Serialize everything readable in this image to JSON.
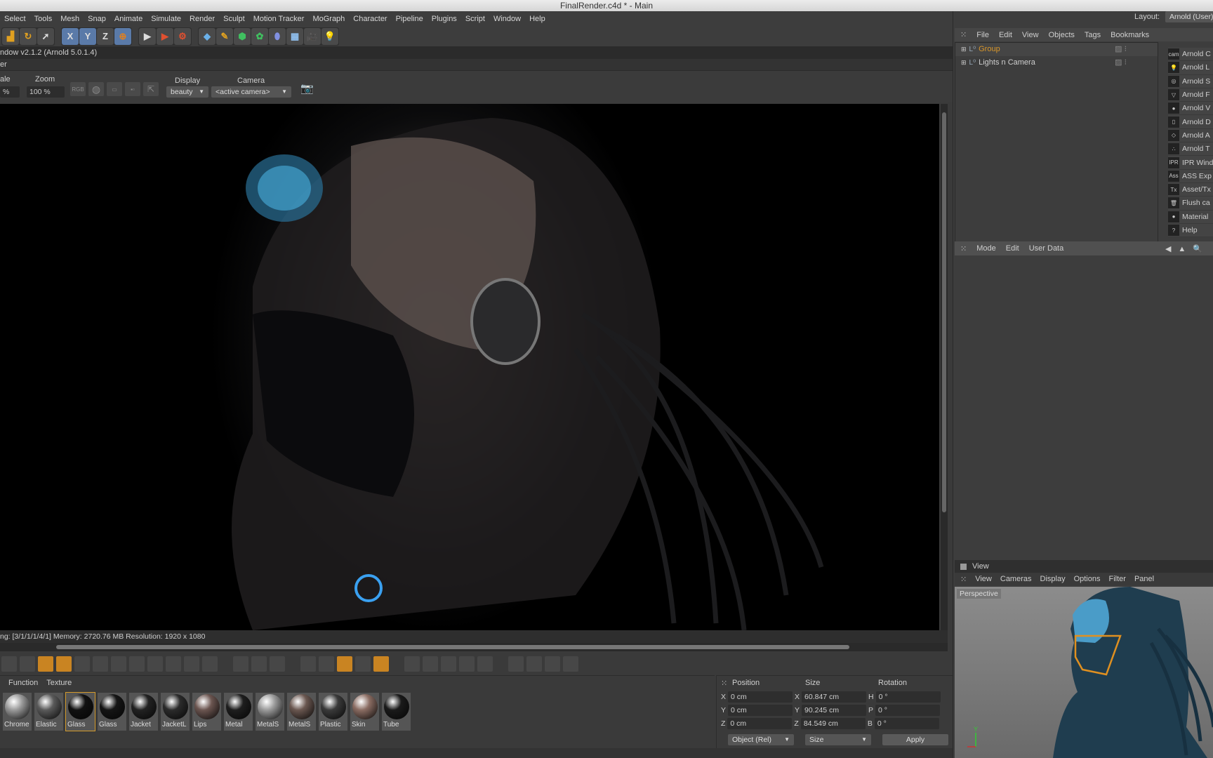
{
  "title": "FinalRender.c4d * - Main",
  "menu": [
    "Select",
    "Tools",
    "Mesh",
    "Snap",
    "Animate",
    "Simulate",
    "Render",
    "Sculpt",
    "Motion Tracker",
    "MoGraph",
    "Character",
    "Pipeline",
    "Plugins",
    "Script",
    "Window",
    "Help"
  ],
  "toolbar": {
    "axis": [
      "X",
      "Y",
      "Z"
    ]
  },
  "render_window": {
    "header": "ndow v2.1.2 (Arnold 5.0.1.4)",
    "sub": "er",
    "scale_label": "ale",
    "scale_value": "%",
    "zoom_label": "Zoom",
    "zoom_value": "100 %",
    "rgb": "RGB",
    "display_label": "Display",
    "display_value": "beauty",
    "camera_label": "Camera",
    "camera_value": "<active camera>",
    "status": "ng: [3/1/1/1/4/1]  Memory: 2720.76 MB  Resolution: 1920 x 1080"
  },
  "materials": {
    "menu": [
      "Function",
      "Texture"
    ],
    "items": [
      {
        "name": "Chrome",
        "color": "#9a9a9a"
      },
      {
        "name": "Elastic",
        "color": "#5a5a5a"
      },
      {
        "name": "Glass",
        "color": "#111111",
        "selected": true
      },
      {
        "name": "Glass",
        "color": "#151515"
      },
      {
        "name": "Jacket",
        "color": "#222222"
      },
      {
        "name": "JacketL",
        "color": "#2b2b2b"
      },
      {
        "name": "Lips",
        "color": "#6b5550"
      },
      {
        "name": "Metal",
        "color": "#1e1e1e"
      },
      {
        "name": "MetalS",
        "color": "#9b9b9b"
      },
      {
        "name": "MetalS",
        "color": "#6a5750"
      },
      {
        "name": "Plastic",
        "color": "#3a3a3a"
      },
      {
        "name": "Skin",
        "color": "#8a6c62"
      },
      {
        "name": "Tube",
        "color": "#1a1a1a"
      }
    ]
  },
  "coords": {
    "headers": [
      "Position",
      "Size",
      "Rotation"
    ],
    "rows": [
      {
        "a": "X",
        "pos": "0 cm",
        "b": "X",
        "size": "60.847 cm",
        "c": "H",
        "rot": "0 °"
      },
      {
        "a": "Y",
        "pos": "0 cm",
        "b": "Y",
        "size": "90.245 cm",
        "c": "P",
        "rot": "0 °"
      },
      {
        "a": "Z",
        "pos": "0 cm",
        "b": "Z",
        "size": "84.549 cm",
        "c": "B",
        "rot": "0 °"
      }
    ],
    "mode": "Object (Rel)",
    "size_mode": "Size",
    "apply": "Apply"
  },
  "layout": {
    "label": "Layout:",
    "value": "Arnold (User)"
  },
  "object_manager": {
    "menu": [
      "File",
      "Edit",
      "View",
      "Objects",
      "Tags",
      "Bookmarks"
    ],
    "objects": [
      {
        "name": "Group",
        "color": "#d8962a"
      },
      {
        "name": "Lights n Camera",
        "color": "#cfcfcf"
      }
    ]
  },
  "plugins": [
    {
      "icon": "cam",
      "label": "Arnold C"
    },
    {
      "icon": "💡",
      "label": "Arnold L"
    },
    {
      "icon": "◎",
      "label": "Arnold S"
    },
    {
      "icon": "▽",
      "label": "Arnold F"
    },
    {
      "icon": "●",
      "label": "Arnold V"
    },
    {
      "icon": "▯",
      "label": "Arnold D"
    },
    {
      "icon": "◇",
      "label": "Arnold A"
    },
    {
      "icon": "∴",
      "label": "Arnold T"
    },
    {
      "icon": "IPR",
      "label": "IPR Wind"
    },
    {
      "icon": "Ass",
      "label": "ASS Exp"
    },
    {
      "icon": "Tx",
      "label": "Asset/Tx"
    },
    {
      "icon": "🗑",
      "label": "Flush ca"
    },
    {
      "icon": "●",
      "label": "Material"
    },
    {
      "icon": "?",
      "label": "Help"
    }
  ],
  "attributes": {
    "menu": [
      "Mode",
      "Edit",
      "User Data"
    ]
  },
  "view_panel": {
    "title": "View",
    "menu": [
      "View",
      "Cameras",
      "Display",
      "Options",
      "Filter",
      "Panel"
    ],
    "camera": "Perspective",
    "axis_y": "Y"
  }
}
